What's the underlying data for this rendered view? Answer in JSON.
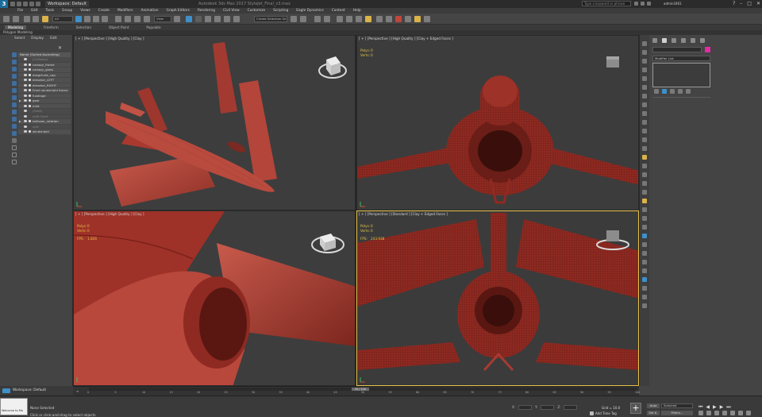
{
  "app": {
    "logo_text": "3",
    "workspace_title": "Workspace: Default",
    "window_title": "Autodesk 3ds Max 2017   StyleJet_Final_v3.max",
    "search_placeholder": "Type a keyword or phrase",
    "user": "admin3461"
  },
  "menu": [
    "File",
    "Edit",
    "Tools",
    "Group",
    "Views",
    "Create",
    "Modifiers",
    "Animation",
    "Graph Editors",
    "Rendering",
    "Civil View",
    "Customize",
    "Scripting",
    "Eagle Dynamics",
    "Content",
    "Help"
  ],
  "toolbar": {
    "view_dropdown": "View",
    "all_dropdown": "All",
    "selection_set": "Create Selection Se"
  },
  "ribbon": {
    "tabs": [
      "Modeling",
      "Freeform",
      "Selection",
      "Object Paint",
      "Populate"
    ],
    "active_tab": "Modeling",
    "sub_label": "Polygon Modeling"
  },
  "explorer": {
    "tabs": [
      "Select",
      "Display",
      "Edit"
    ],
    "header": "Name (Sorted Ascending)",
    "rows": [
      {
        "name": "(Collision)",
        "dim": true,
        "expander": ""
      },
      {
        "name": "canopy_frame",
        "dim": false,
        "expander": ""
      },
      {
        "name": "canopy_glass",
        "dim": false,
        "expander": ""
      },
      {
        "name": "dragchute_cap",
        "dim": false,
        "expander": ""
      },
      {
        "name": "elevator_LEFT",
        "dim": false,
        "expander": ""
      },
      {
        "name": "elevator_RIGHT",
        "dim": false,
        "expander": ""
      },
      {
        "name": "Front windshield frame",
        "dim": false,
        "expander": ""
      },
      {
        "name": "fuselage",
        "dim": false,
        "expander": ""
      },
      {
        "name": "gear",
        "dim": false,
        "expander": "▶"
      },
      {
        "name": "mild",
        "dim": false,
        "expander": ""
      },
      {
        "name": "(Omit)",
        "dim": true,
        "expander": ""
      },
      {
        "name": "mild Omit",
        "dim": true,
        "expander": ""
      },
      {
        "name": "tailhook_rotation",
        "dim": false,
        "expander": "▶"
      },
      {
        "name": "vert",
        "dim": true,
        "expander": ""
      },
      {
        "name": "windshield",
        "dim": false,
        "expander": ""
      }
    ]
  },
  "viewports": [
    {
      "label": "[ + ] [Perspective ] [High Quality ] [Clay ]",
      "show_stats": false
    },
    {
      "label": "[ + ] [Perspective ] [High Quality ] [Clay + Edged Faces ]",
      "show_stats": true,
      "polys": "0",
      "verts": "0",
      "fps": ""
    },
    {
      "label": "[ + ] [Perspective ] [High Quality ] [Clay ]",
      "show_stats": true,
      "polys": "0",
      "verts": "0",
      "fps": "1.826"
    },
    {
      "label": "[ + ] [Perspective ] [Standard ] [Clay + Edged Faces ]",
      "show_stats": true,
      "polys": "0",
      "verts": "0",
      "fps": "243.938"
    }
  ],
  "stat_labels": {
    "polys": "Polys:",
    "verts": "Verts:",
    "fps": "FPS:"
  },
  "command_panel": {
    "modifier_list": "Modifier List",
    "object_color": "#e32ba3"
  },
  "timeline": {
    "frame_indicator": "50 / 100",
    "ticks": [
      "0",
      "5",
      "10",
      "15",
      "20",
      "25",
      "30",
      "35",
      "40",
      "45",
      "50",
      "55",
      "60",
      "65",
      "70",
      "75",
      "80",
      "85",
      "90",
      "95",
      "100"
    ]
  },
  "workspace_bar": {
    "label": "Workspace: Default"
  },
  "status": {
    "script_label": "Welcome to Ma",
    "line1": "None Selected",
    "line2": "Click or click-and-drag to select objects",
    "grid": "Grid = 10.0",
    "add_time_tag": "Add Time Tag",
    "auto_label": "Auto",
    "set_k_label": "Set K.",
    "selected_dropdown": "Selected",
    "filters_label": "Filters..."
  },
  "colors": {
    "clay": "#b3453a",
    "active_viewport_border": "#e7c34a",
    "stat_text": "#e0c848"
  }
}
